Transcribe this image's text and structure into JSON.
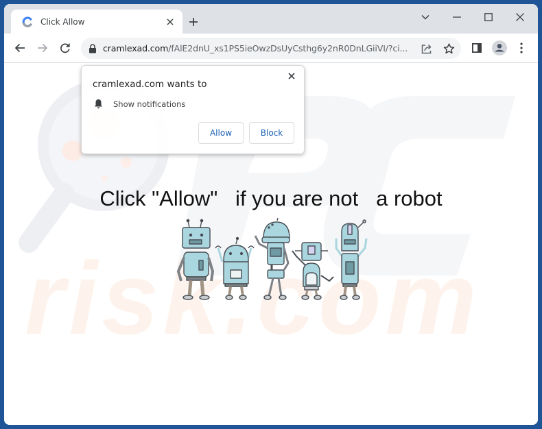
{
  "browser": {
    "tab": {
      "title": "Click Allow",
      "favicon": "loading-favicon-icon",
      "close_icon": "close-icon"
    },
    "new_tab_icon": "plus-icon",
    "window_controls": {
      "tab_search": "chevron-down-icon",
      "minimize": "minimize-icon",
      "maximize": "maximize-icon",
      "close": "close-icon"
    },
    "toolbar": {
      "back": "arrow-left-icon",
      "forward": "arrow-right-icon",
      "reload": "reload-icon",
      "address": {
        "security_icon": "lock-icon",
        "host": "cramlexad.com",
        "path": "/fAlE2dnU_xs1PS5ieOwzDsUyCsthg6y2nR0DnLGiiVI/?ci..."
      },
      "share_icon": "share-icon",
      "bookmark_icon": "star-icon",
      "side_panel_icon": "side-panel-icon",
      "profile_icon": "profile-avatar-icon",
      "menu_icon": "kebab-menu-icon"
    }
  },
  "permission_popup": {
    "title": "cramlexad.com wants to",
    "permission": {
      "icon": "bell-icon",
      "label": "Show notifications"
    },
    "allow_label": "Allow",
    "block_label": "Block",
    "colors": {
      "button_text": "#1a5fb4"
    }
  },
  "page": {
    "headline": "Click \"Allow\"   if you are not   a robot",
    "illustration": "five cartoon robots",
    "watermark": "PCrisk.com"
  }
}
